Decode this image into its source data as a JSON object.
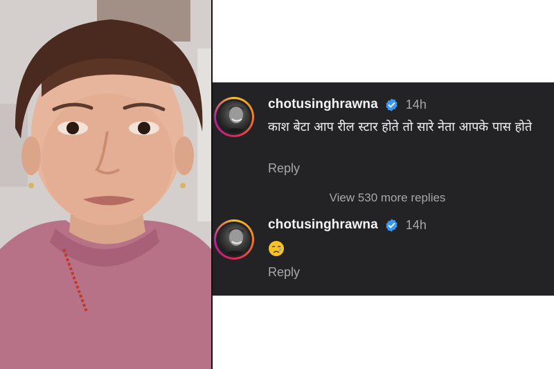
{
  "comments": [
    {
      "username": "chotusinghrawna",
      "time": "14h",
      "text": "काश बेटा आप रील स्टार होते तो सारे नेता आपके पास होते",
      "reply_label": "Reply"
    },
    {
      "username": "chotusinghrawna",
      "time": "14h",
      "emoji": "crying-face",
      "reply_label": "Reply"
    }
  ],
  "view_more_label": "View 530 more replies",
  "colors": {
    "panel_bg": "#232325",
    "secondary_text": "#a8a8a8",
    "verified_blue": "#3897f0"
  }
}
